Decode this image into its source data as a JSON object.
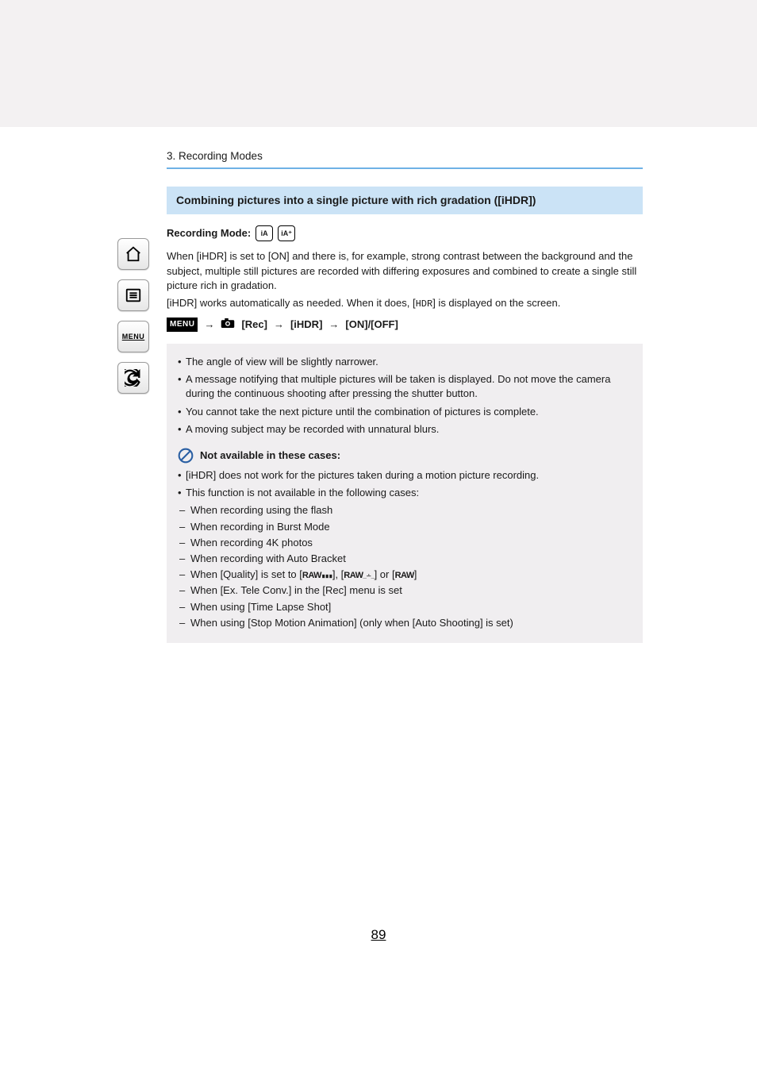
{
  "breadcrumb": "3. Recording Modes",
  "section_title": "Combining pictures into a single picture with rich gradation ([iHDR])",
  "recording_mode_label": "Recording Mode:",
  "mode_icons": {
    "a": "iA",
    "b": "iA⁺"
  },
  "intro_p1": "When [iHDR] is set to [ON] and there is, for example, strong contrast between the background and the subject, multiple still pictures are recorded with differing exposures and combined to create a single still picture rich in gradation.",
  "intro_p2_a": "[iHDR] works automatically as needed. When it does, [",
  "intro_hdr_glyph": "HDR",
  "intro_p2_b": "] is displayed on the screen.",
  "menu_badge": "MENU",
  "menu_arrow": "→",
  "menu_rec": "[Rec]",
  "menu_ihdr": "[iHDR]",
  "menu_onoff": "[ON]/[OFF]",
  "notes": [
    "The angle of view will be slightly narrower.",
    "A message notifying that multiple pictures will be taken is displayed. Do not move the camera during the continuous shooting after pressing the shutter button.",
    "You cannot take the next picture until the combination of pictures is complete.",
    "A moving subject may be recorded with unnatural blurs."
  ],
  "na_title": "Not available in these cases:",
  "na_bullets": [
    "[iHDR] does not work for the pictures taken during a motion picture recording.",
    "This function is not available in the following cases:"
  ],
  "na_sublist_pre_quality": [
    "When recording using the flash",
    "When recording in Burst Mode",
    "When recording 4K photos",
    "When recording with Auto Bracket"
  ],
  "quality_line": {
    "prefix": "When [Quality] is set to [",
    "g1": "RAW␡",
    "mid1": "], [",
    "g2": "RAW±",
    "mid2": "] or [",
    "g3": "RAW",
    "suffix": "]"
  },
  "na_sublist_post_quality": [
    "When [Ex. Tele Conv.] in the [Rec] menu is set",
    "When using [Time Lapse Shot]",
    "When using [Stop Motion Animation] (only when [Auto Shooting] is set)"
  ],
  "page_number": "89",
  "sidebar": {
    "home": "home-icon",
    "toc": "toc-icon",
    "menu": "menu-icon",
    "back": "back-icon"
  }
}
